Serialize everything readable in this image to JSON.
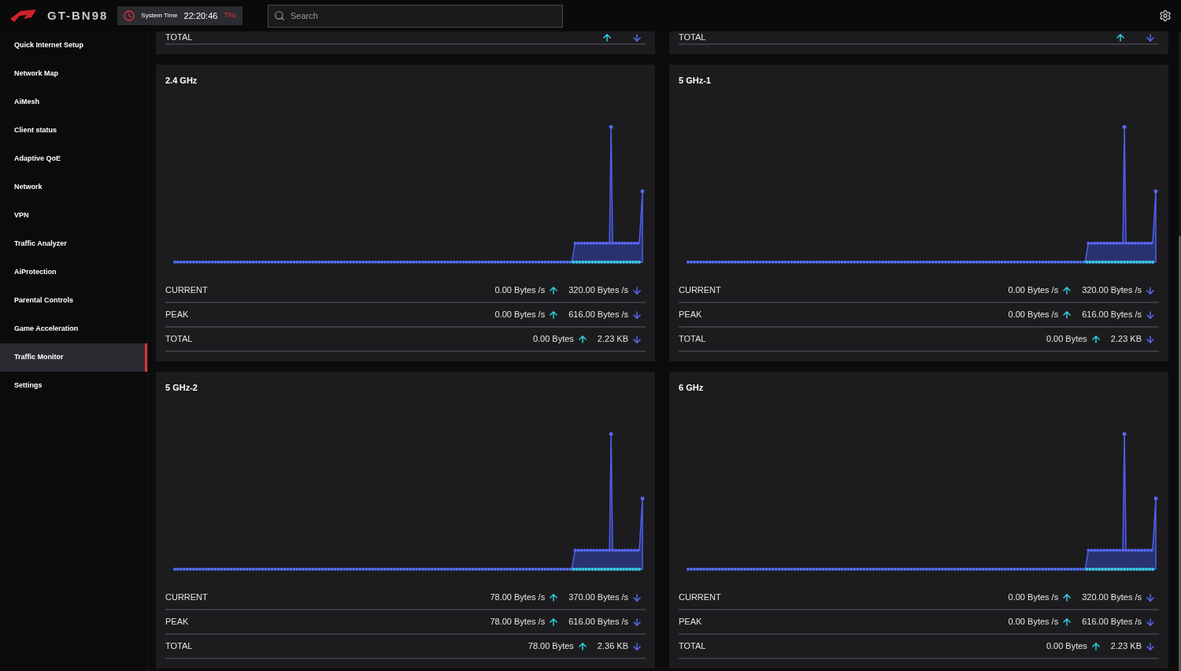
{
  "header": {
    "model": "GT-BN98",
    "system_time_label": "System Time",
    "time": "22:20:46",
    "day": "Thu",
    "search": {
      "placeholder": "Search"
    }
  },
  "sidebar": {
    "items": [
      {
        "label": "Quick Internet Setup",
        "selected": false
      },
      {
        "label": "Network Map",
        "selected": false
      },
      {
        "label": "AiMesh",
        "selected": false
      },
      {
        "label": "Client status",
        "selected": false
      },
      {
        "label": "Adaptive QoE",
        "selected": false
      },
      {
        "label": "Network",
        "selected": false
      },
      {
        "label": "VPN",
        "selected": false
      },
      {
        "label": "Traffic Analyzer",
        "selected": false
      },
      {
        "label": "AiProtection",
        "selected": false
      },
      {
        "label": "Parental Controls",
        "selected": false
      },
      {
        "label": "Game Acceleration",
        "selected": false
      },
      {
        "label": "Traffic Monitor",
        "selected": true
      },
      {
        "label": "Settings",
        "selected": false
      }
    ]
  },
  "partial_cards": [
    {
      "label": "TOTAL"
    },
    {
      "label": "TOTAL"
    }
  ],
  "bands": [
    {
      "title": "2.4 GHz",
      "rows": [
        {
          "label": "CURRENT",
          "upload": "0.00 Bytes /s",
          "download": "320.00 Bytes /s"
        },
        {
          "label": "PEAK",
          "upload": "0.00 Bytes /s",
          "download": "616.00 Bytes /s"
        },
        {
          "label": "TOTAL",
          "upload": "0.00 Bytes",
          "download": "2.23 KB"
        }
      ]
    },
    {
      "title": "5 GHz-1",
      "rows": [
        {
          "label": "CURRENT",
          "upload": "0.00 Bytes /s",
          "download": "320.00 Bytes /s"
        },
        {
          "label": "PEAK",
          "upload": "0.00 Bytes /s",
          "download": "616.00 Bytes /s"
        },
        {
          "label": "TOTAL",
          "upload": "0.00 Bytes",
          "download": "2.23 KB"
        }
      ]
    },
    {
      "title": "5 GHz-2",
      "rows": [
        {
          "label": "CURRENT",
          "upload": "78.00 Bytes /s",
          "download": "370.00 Bytes /s"
        },
        {
          "label": "PEAK",
          "upload": "78.00 Bytes /s",
          "download": "616.00 Bytes /s"
        },
        {
          "label": "TOTAL",
          "upload": "78.00 Bytes",
          "download": "2.36 KB"
        }
      ]
    },
    {
      "title": "6 GHz",
      "rows": [
        {
          "label": "CURRENT",
          "upload": "0.00 Bytes /s",
          "download": "320.00 Bytes /s"
        },
        {
          "label": "PEAK",
          "upload": "0.00 Bytes /s",
          "download": "616.00 Bytes /s"
        },
        {
          "label": "TOTAL",
          "upload": "0.00 Bytes",
          "download": "2.23 KB"
        }
      ]
    }
  ]
}
